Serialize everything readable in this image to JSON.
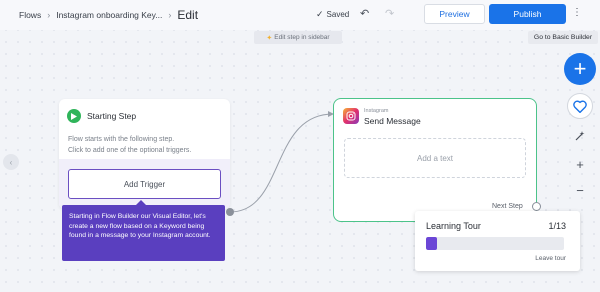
{
  "header": {
    "breadcrumb_root": "Flows",
    "breadcrumb_flow": "Instagram onboarding Key...",
    "page_title": "Edit",
    "saved_label": "Saved",
    "preview_label": "Preview",
    "publish_label": "Publish"
  },
  "canvas": {
    "hint": "Edit step in sidebar",
    "basic_builder_tooltip": "Go to Basic Builder"
  },
  "start_step": {
    "title": "Starting Step",
    "description_line1": "Flow starts with the following step.",
    "description_line2": "Click to add one of the optional triggers.",
    "add_trigger_label": "Add Trigger"
  },
  "tour_tooltip": {
    "text": "Starting in Flow Builder our Visual Editor, let's create a new flow based on a Keyword being found in a message to your Instagram account."
  },
  "send_message": {
    "channel": "Instagram",
    "title": "Send Message",
    "add_text_label": "Add a text",
    "next_step_label": "Next Step"
  },
  "learning_tour": {
    "title": "Learning Tour",
    "count": "1/13",
    "progress": 0.077,
    "leave_label": "Leave tour"
  },
  "colors": {
    "accent": "#1a73e8",
    "tour_purple": "#5a3fbf",
    "node_border_green": "#4cc38a",
    "start_icon_green": "#2fb45a"
  }
}
